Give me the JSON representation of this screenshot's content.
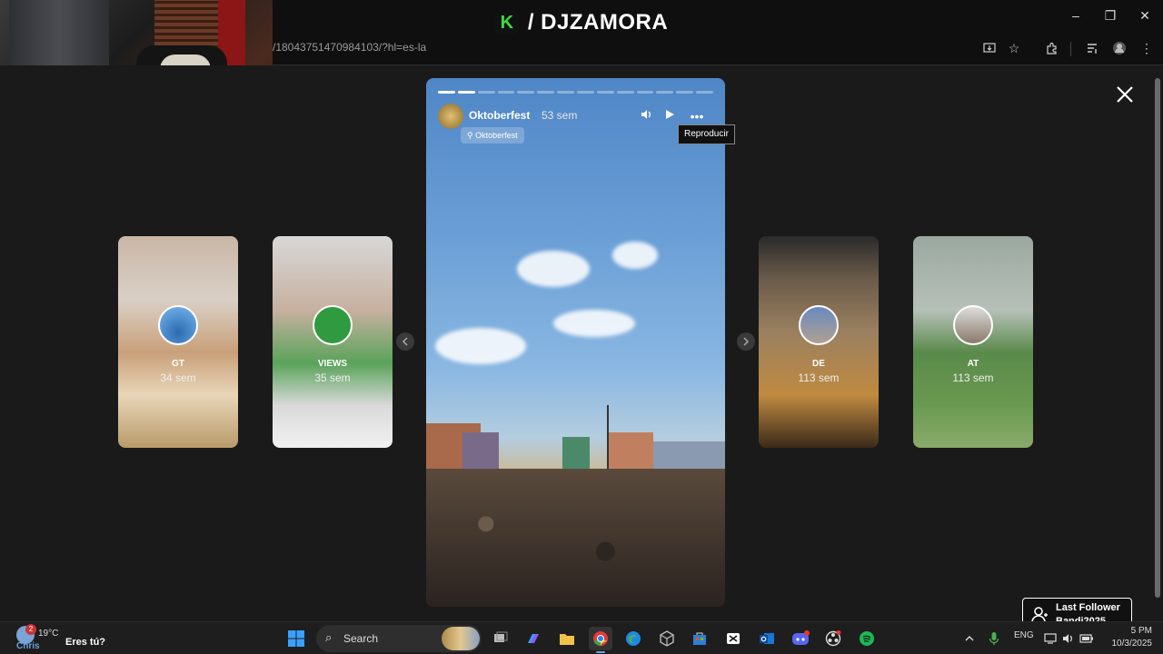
{
  "browser": {
    "url": "/18043751470984103/?hl=es-la"
  },
  "window_controls": {
    "minimize": "–",
    "restore": "❐",
    "close": "✕"
  },
  "brand": {
    "logo_letter": "K",
    "name": "/ DJZAMORA"
  },
  "story": {
    "user": "Oktoberfest",
    "time": "53 sem",
    "location": "Oktoberfest",
    "tooltip": "Reproducir",
    "segments_total": 14,
    "segments_done": 2
  },
  "side_stories": [
    {
      "user": "GT",
      "time": "34 sem"
    },
    {
      "user": "VIEWS",
      "time": "35 sem"
    },
    {
      "user": "DE",
      "time": "113 sem"
    },
    {
      "user": "AT",
      "time": "113 sem"
    }
  ],
  "follower_widget": {
    "label": "Last Follower",
    "name": "Bandi2025"
  },
  "taskbar": {
    "weather_temp": "19°C",
    "weather_badge": "2",
    "weather_loc": "Chris",
    "overlay_text": "Eres tú?",
    "search_label": "Search",
    "lang": "ENG",
    "time": "5 PM",
    "date": "10/3/2025"
  },
  "colors": {
    "accent_green": "#3ddc3d",
    "taskbar_bg": "#1e1e1e",
    "spotify_green": "#1db954"
  }
}
